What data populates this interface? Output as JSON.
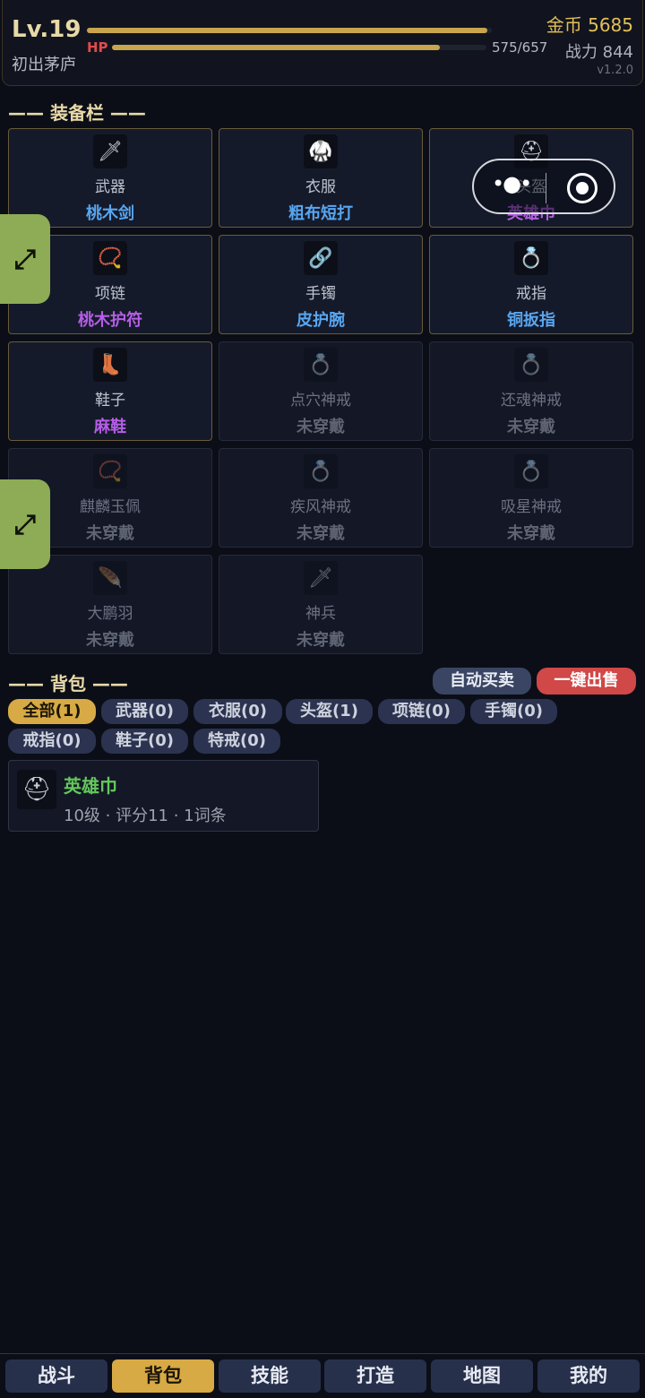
{
  "header": {
    "level": "Lv.19",
    "realm": "初出茅庐",
    "exp_progress": 0.99,
    "hp_label": "HP",
    "hp_value": "575/657",
    "hp_progress": 0.875,
    "gold": "金币 5685",
    "power": "战力 844",
    "version": "v1.2.0"
  },
  "equipment": {
    "title": "—— 装备栏 ——",
    "slots": [
      {
        "slot": "武器",
        "item": "桃木剑",
        "quality": "blue",
        "icon": "sword-icon",
        "glyph": "🗡"
      },
      {
        "slot": "衣服",
        "item": "粗布短打",
        "quality": "blue",
        "icon": "armor-icon",
        "glyph": "🥋"
      },
      {
        "slot": "头盔",
        "item": "英雄巾",
        "quality": "purple",
        "icon": "helmet-icon",
        "glyph": "⛑"
      },
      {
        "slot": "项链",
        "item": "桃木护符",
        "quality": "purple",
        "icon": "necklace-icon",
        "glyph": "📿"
      },
      {
        "slot": "手镯",
        "item": "皮护腕",
        "quality": "blue",
        "icon": "bracelet-icon",
        "glyph": "🔗"
      },
      {
        "slot": "戒指",
        "item": "铜扳指",
        "quality": "blue",
        "icon": "ring-icon",
        "glyph": "💍"
      },
      {
        "slot": "鞋子",
        "item": "麻鞋",
        "quality": "purple",
        "icon": "boots-icon",
        "glyph": "👢"
      },
      {
        "slot": "点穴神戒",
        "item": "未穿戴",
        "quality": "none",
        "icon": "ring-icon",
        "glyph": "💍"
      },
      {
        "slot": "还魂神戒",
        "item": "未穿戴",
        "quality": "none",
        "icon": "ring-icon",
        "glyph": "💍"
      },
      {
        "slot": "麒麟玉佩",
        "item": "未穿戴",
        "quality": "none",
        "icon": "jade-pendant-icon",
        "glyph": "📿"
      },
      {
        "slot": "疾风神戒",
        "item": "未穿戴",
        "quality": "none",
        "icon": "ring-icon",
        "glyph": "💍"
      },
      {
        "slot": "吸星神戒",
        "item": "未穿戴",
        "quality": "none",
        "icon": "ring-icon",
        "glyph": "💍"
      },
      {
        "slot": "大鹏羽",
        "item": "未穿戴",
        "quality": "none",
        "icon": "wings-icon",
        "glyph": "🪶"
      },
      {
        "slot": "神兵",
        "item": "未穿戴",
        "quality": "none",
        "icon": "sword-icon",
        "glyph": "🗡"
      }
    ]
  },
  "bag": {
    "title": "—— 背包 ——",
    "auto_trade": "自动买卖",
    "quick_sell": "一键出售",
    "filters": [
      {
        "label": "全部(1)",
        "active": true
      },
      {
        "label": "武器(0)",
        "active": false
      },
      {
        "label": "衣服(0)",
        "active": false
      },
      {
        "label": "头盔(1)",
        "active": false
      },
      {
        "label": "项链(0)",
        "active": false
      },
      {
        "label": "手镯(0)",
        "active": false
      },
      {
        "label": "戒指(0)",
        "active": false
      },
      {
        "label": "鞋子(0)",
        "active": false
      },
      {
        "label": "特戒(0)",
        "active": false
      }
    ],
    "items": [
      {
        "name": "英雄巾",
        "meta": "10级 · 评分11 · 1词条",
        "quality": "green",
        "icon": "helmet-icon",
        "glyph": "⛑"
      }
    ]
  },
  "nav": {
    "tabs": [
      {
        "label": "战斗",
        "active": false
      },
      {
        "label": "背包",
        "active": true
      },
      {
        "label": "技能",
        "active": false
      },
      {
        "label": "打造",
        "active": false
      },
      {
        "label": "地图",
        "active": false
      },
      {
        "label": "我的",
        "active": false
      }
    ]
  },
  "colors": {
    "accent_gold": "#d7aa45",
    "quality_blue": "#58a6f0",
    "quality_purple": "#b55ee6",
    "quality_green": "#63c85a",
    "danger_red": "#d04848"
  }
}
